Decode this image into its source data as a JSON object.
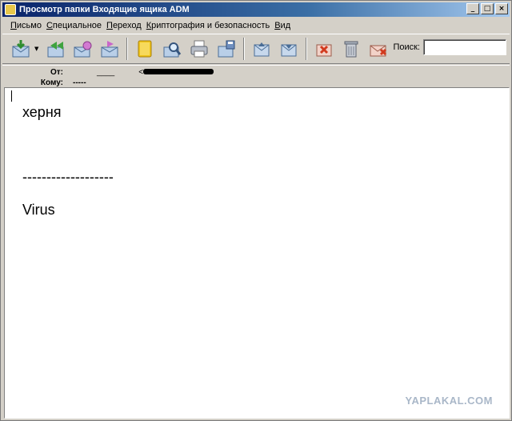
{
  "window": {
    "title": "Просмотр папки Входящие ящика ADM"
  },
  "window_controls": {
    "minimize": "_",
    "maximize": "□",
    "close": "×"
  },
  "menu": [
    "Письмо",
    "Специальное",
    "Переход",
    "Криптография и безопасность",
    "Вид"
  ],
  "toolbar": {
    "buttons": [
      "get-mail-icon",
      "reply-icon",
      "reply-all-icon",
      "forward-icon",
      "redirect-icon",
      "address-book-icon",
      "find-icon",
      "print-icon",
      "save-icon",
      "previous-icon",
      "next-icon",
      "delete-mark-icon",
      "trash-icon",
      "delete-icon"
    ],
    "search_label": "Поиск:",
    "search_value": ""
  },
  "header": {
    "from_label": "От:",
    "from_value": "____",
    "from_addr_prefix": "<",
    "to_label": "Кому:",
    "to_value": "-----"
  },
  "message": {
    "line1": "херня",
    "separator": "-------------------",
    "line2": "Virus"
  },
  "watermark": "YAPLAKAL.COM"
}
